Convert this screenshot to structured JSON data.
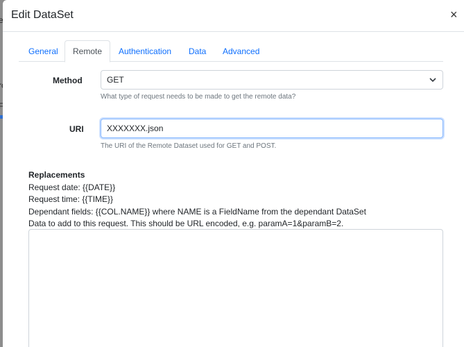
{
  "background": {
    "fragments": [
      "e",
      "ro",
      "F"
    ]
  },
  "modal": {
    "title": "Edit DataSet",
    "close": "×"
  },
  "tabs": [
    {
      "label": "General",
      "active": false
    },
    {
      "label": "Remote",
      "active": true
    },
    {
      "label": "Authentication",
      "active": false
    },
    {
      "label": "Data",
      "active": false
    },
    {
      "label": "Advanced",
      "active": false
    }
  ],
  "method": {
    "label": "Method",
    "value": "GET",
    "help": "What type of request needs to be made to get the remote data?"
  },
  "uri": {
    "label": "URI",
    "value": "XXXXXXX.json",
    "help": "The URI of the Remote Dataset used for GET and POST."
  },
  "replacements": {
    "heading": "Replacements",
    "lines": [
      "Request date: {{DATE}}",
      "Request time: {{TIME}}",
      "Dependant fields: {{COL.NAME}} where NAME is a FieldName from the dependant DataSet",
      "Data to add to this request. This should be URL encoded, e.g. paramA=1&paramB=2."
    ]
  },
  "post_data": {
    "value": ""
  },
  "colors": {
    "accent": "#0d6efd",
    "focus_border": "#86b7fe",
    "muted": "#6c757d"
  }
}
